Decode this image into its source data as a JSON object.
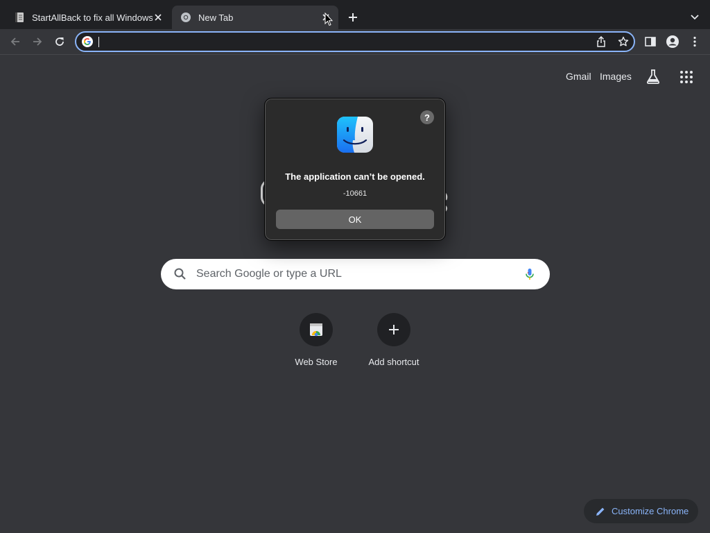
{
  "tabs": [
    {
      "title": "StartAllBack to fix all Windows",
      "active": false,
      "icon": "document-icon"
    },
    {
      "title": "New Tab",
      "active": true,
      "icon": "chrome-icon"
    }
  ],
  "toolbar": {
    "omnibox_value": "",
    "icons": [
      "back-icon",
      "forward-icon",
      "reload-icon",
      "share-icon",
      "bookmark-star-icon",
      "side-panel-icon",
      "profile-icon",
      "menu-icon"
    ]
  },
  "ntp": {
    "links": {
      "gmail": "Gmail",
      "images": "Images"
    },
    "search_placeholder": "Search Google or type a URL",
    "shortcuts": [
      {
        "label": "Web Store",
        "icon": "web-store-icon"
      },
      {
        "label": "Add shortcut",
        "icon": "plus-icon"
      }
    ],
    "customize_label": "Customize Chrome"
  },
  "dialog": {
    "title": "The application can’t be opened.",
    "code": "-10661",
    "ok_label": "OK",
    "help_label": "?",
    "icon": "finder-icon"
  },
  "colors": {
    "background": "#35363a",
    "tabstrip": "#202124",
    "accent": "#8ab4f8"
  }
}
